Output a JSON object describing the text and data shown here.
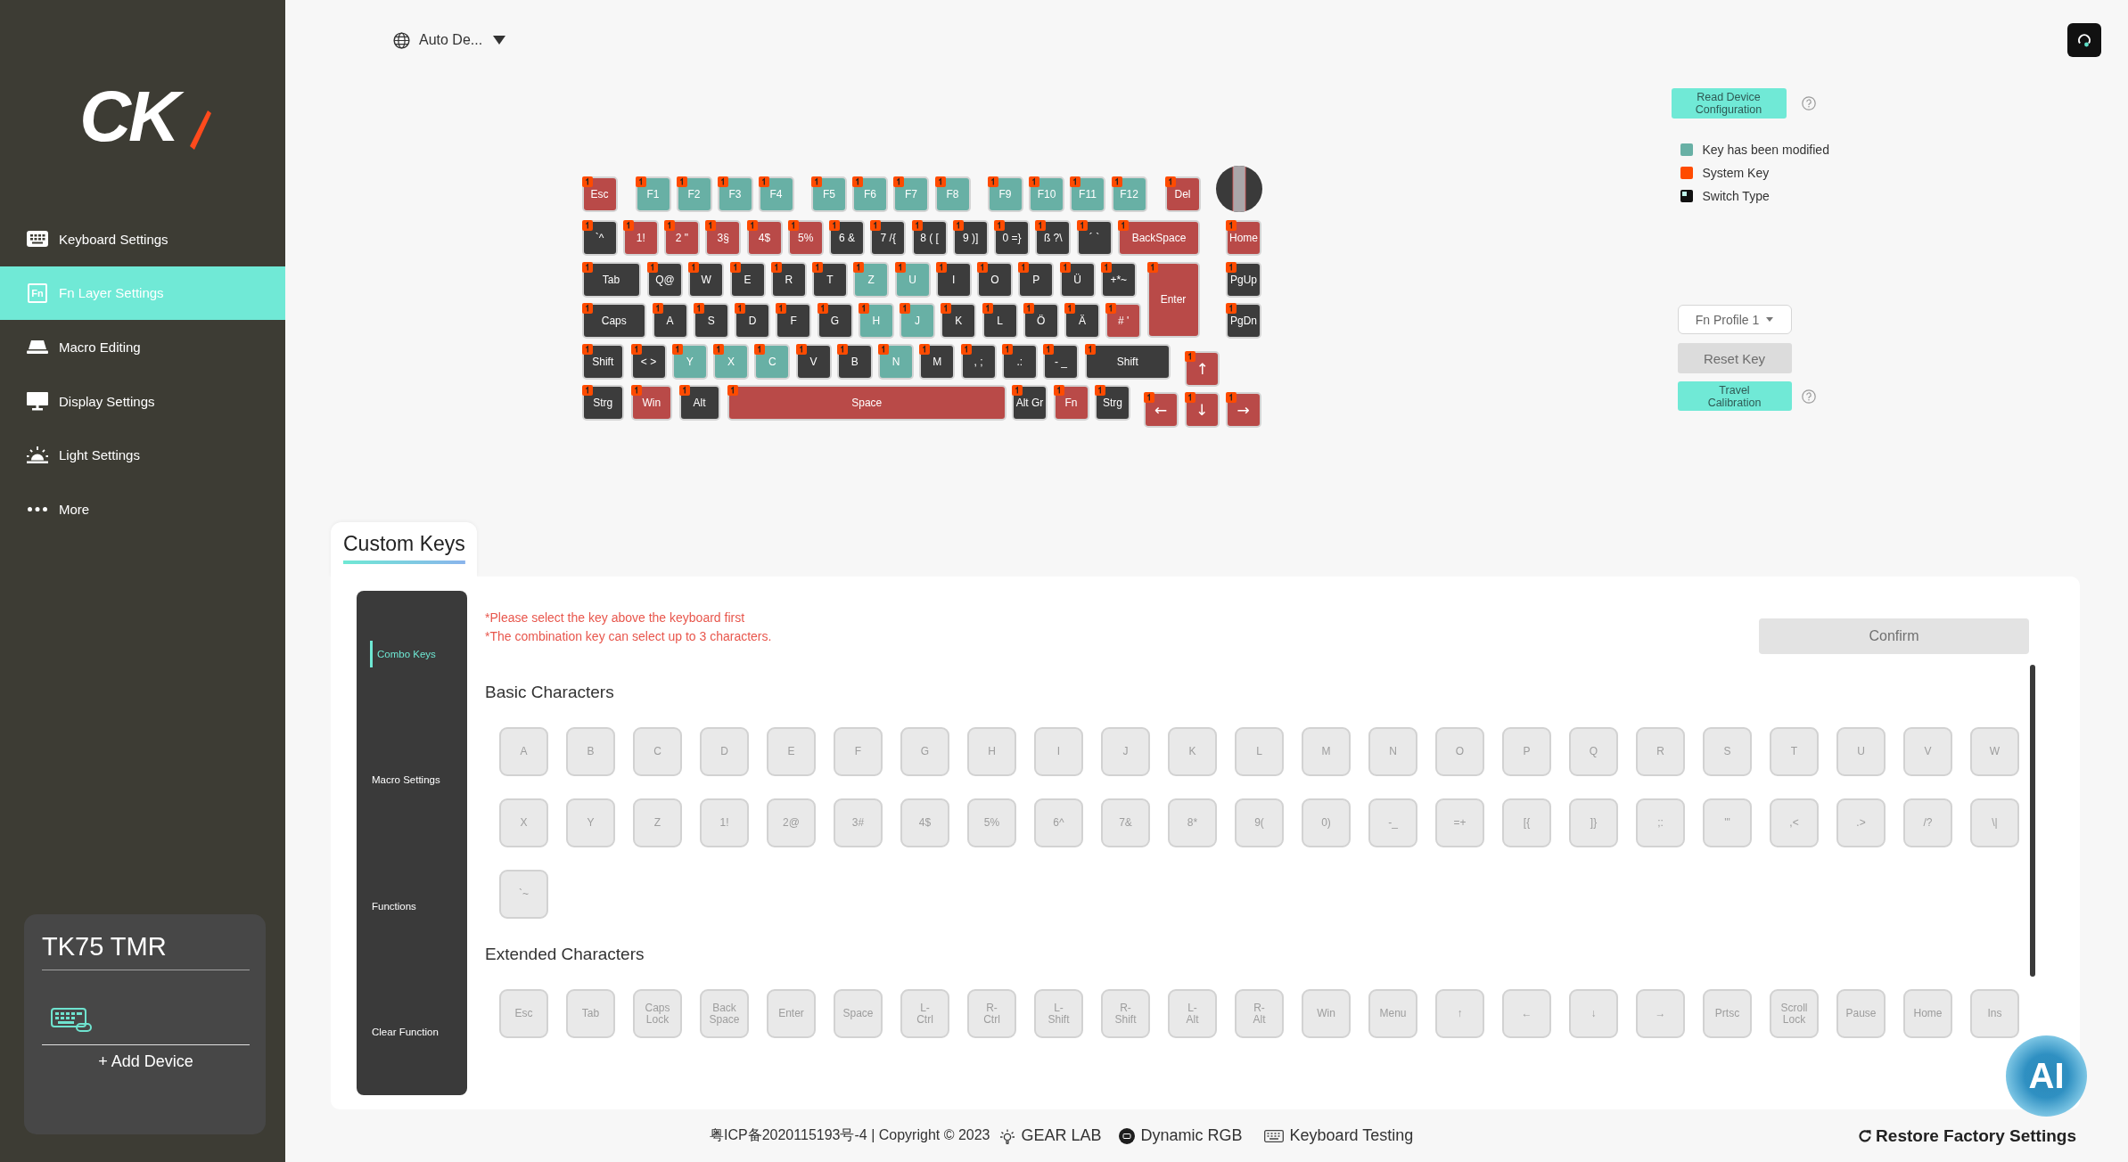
{
  "top_bar": {
    "language": "Auto De..."
  },
  "sidebar": {
    "logo": "CK",
    "items": [
      {
        "label": "Keyboard Settings",
        "selected": false
      },
      {
        "label": "Fn Layer Settings",
        "selected": true,
        "icon_label": "Fn"
      },
      {
        "label": "Macro Editing",
        "selected": false
      },
      {
        "label": "Display Settings",
        "selected": false
      },
      {
        "label": "Light Settings",
        "selected": false
      },
      {
        "label": "More",
        "selected": false
      }
    ],
    "device": {
      "name": "TK75 TMR",
      "add_button": "+ Add Device"
    }
  },
  "keyboard": {
    "rows": [
      {
        "keys": [
          {
            "label": "Esc",
            "color": "#b94a48",
            "system": true
          },
          {
            "label": "F1",
            "color": "#68b0a5",
            "system": true
          },
          {
            "label": "F2",
            "color": "#68b0a5",
            "system": true
          },
          {
            "label": "F3",
            "color": "#68b0a5",
            "system": true
          },
          {
            "label": "F4",
            "color": "#68b0a5",
            "system": true
          },
          {
            "label": "F5",
            "color": "#68b0a5",
            "system": true
          },
          {
            "label": "F6",
            "color": "#68b0a5",
            "system": true
          },
          {
            "label": "F7",
            "color": "#68b0a5",
            "system": true
          },
          {
            "label": "F8",
            "color": "#68b0a5",
            "system": true
          },
          {
            "label": "F9",
            "color": "#68b0a5",
            "system": true
          },
          {
            "label": "F10",
            "color": "#68b0a5",
            "system": true
          },
          {
            "label": "F11",
            "color": "#68b0a5",
            "system": true
          },
          {
            "label": "F12",
            "color": "#68b0a5",
            "system": true
          },
          {
            "label": "Del",
            "color": "#b94a48",
            "system": true
          }
        ]
      },
      {
        "keys": [
          {
            "label": "`^",
            "color": "#3c3c3c",
            "system": true
          },
          {
            "label": "1!",
            "color": "#b94a48",
            "system": true
          },
          {
            "label": "2 \"",
            "color": "#b94a48",
            "system": true
          },
          {
            "label": "3§",
            "color": "#b94a48",
            "system": true
          },
          {
            "label": "4$",
            "color": "#b94a48",
            "system": true
          },
          {
            "label": "5%",
            "color": "#b94a48",
            "system": true
          },
          {
            "label": "6 &",
            "color": "#3c3c3c",
            "system": true
          },
          {
            "label": "7 /{",
            "color": "#3c3c3c",
            "system": true
          },
          {
            "label": "8 ( [",
            "color": "#3c3c3c",
            "system": true
          },
          {
            "label": "9 )]",
            "color": "#3c3c3c",
            "system": true
          },
          {
            "label": "0 =}",
            "color": "#3c3c3c",
            "system": true
          },
          {
            "label": "ß ?\\",
            "color": "#3c3c3c",
            "system": true
          },
          {
            "label": "´ `",
            "color": "#3c3c3c",
            "system": true
          },
          {
            "label": "BackSpace",
            "color": "#b94a48",
            "system": true
          },
          {
            "label": "Home",
            "color": "#b94a48",
            "system": true
          }
        ]
      },
      {
        "keys": [
          {
            "label": "Tab",
            "color": "#3c3c3c",
            "system": true
          },
          {
            "label": "Q@",
            "color": "#3c3c3c",
            "system": true
          },
          {
            "label": "W",
            "color": "#3c3c3c",
            "system": true
          },
          {
            "label": "E",
            "color": "#3c3c3c",
            "system": true
          },
          {
            "label": "R",
            "color": "#3c3c3c",
            "system": true
          },
          {
            "label": "T",
            "color": "#3c3c3c",
            "system": true
          },
          {
            "label": "Z",
            "color": "#68b0a5",
            "system": true
          },
          {
            "label": "U",
            "color": "#68b0a5",
            "system": true
          },
          {
            "label": "I",
            "color": "#3c3c3c",
            "system": true
          },
          {
            "label": "O",
            "color": "#3c3c3c",
            "system": true
          },
          {
            "label": "P",
            "color": "#3c3c3c",
            "system": true
          },
          {
            "label": "Ü",
            "color": "#3c3c3c",
            "system": true
          },
          {
            "label": "+*~",
            "color": "#3c3c3c",
            "system": true
          },
          {
            "label": "Enter",
            "color": "#b94a48",
            "system": true
          },
          {
            "label": "PgUp",
            "color": "#3c3c3c",
            "system": true
          }
        ]
      },
      {
        "keys": [
          {
            "label": "Caps",
            "color": "#3c3c3c",
            "system": true
          },
          {
            "label": "A",
            "color": "#3c3c3c",
            "system": true
          },
          {
            "label": "S",
            "color": "#3c3c3c",
            "system": true
          },
          {
            "label": "D",
            "color": "#3c3c3c",
            "system": true
          },
          {
            "label": "F",
            "color": "#3c3c3c",
            "system": true
          },
          {
            "label": "G",
            "color": "#3c3c3c",
            "system": true
          },
          {
            "label": "H",
            "color": "#68b0a5",
            "system": true
          },
          {
            "label": "J",
            "color": "#68b0a5",
            "system": true
          },
          {
            "label": "K",
            "color": "#3c3c3c",
            "system": true
          },
          {
            "label": "L",
            "color": "#3c3c3c",
            "system": true
          },
          {
            "label": "Ö",
            "color": "#3c3c3c",
            "system": true
          },
          {
            "label": "Ä",
            "color": "#3c3c3c",
            "system": true
          },
          {
            "label": "# '",
            "color": "#b94a48",
            "system": true
          },
          {
            "label": "PgDn",
            "color": "#3c3c3c",
            "system": true
          }
        ]
      },
      {
        "keys": [
          {
            "label": "Shift",
            "color": "#3c3c3c",
            "system": true
          },
          {
            "label": "< >",
            "color": "#3c3c3c",
            "system": true
          },
          {
            "label": "Y",
            "color": "#68b0a5",
            "system": true
          },
          {
            "label": "X",
            "color": "#68b0a5",
            "system": true
          },
          {
            "label": "C",
            "color": "#68b0a5",
            "system": true
          },
          {
            "label": "V",
            "color": "#3c3c3c",
            "system": true
          },
          {
            "label": "B",
            "color": "#3c3c3c",
            "system": true
          },
          {
            "label": "N",
            "color": "#68b0a5",
            "system": true
          },
          {
            "label": "M",
            "color": "#3c3c3c",
            "system": true
          },
          {
            "label": ", ;",
            "color": "#3c3c3c",
            "system": true
          },
          {
            "label": ".:",
            "color": "#3c3c3c",
            "system": true
          },
          {
            "label": "- _",
            "color": "#3c3c3c",
            "system": true
          },
          {
            "label": "Shift",
            "color": "#3c3c3c",
            "system": true
          },
          {
            "label": "↑",
            "color": "#b94a48",
            "system": true
          }
        ]
      },
      {
        "keys": [
          {
            "label": "Strg",
            "color": "#3c3c3c",
            "system": true
          },
          {
            "label": "Win",
            "color": "#b94a48",
            "system": true
          },
          {
            "label": "Alt",
            "color": "#3c3c3c",
            "system": true
          },
          {
            "label": "Space",
            "color": "#b94a48",
            "system": true
          },
          {
            "label": "Alt Gr",
            "color": "#3c3c3c",
            "system": true
          },
          {
            "label": "Fn",
            "color": "#b94a48",
            "system": true
          },
          {
            "label": "Strg",
            "color": "#3c3c3c",
            "system": true
          },
          {
            "label": "←",
            "color": "#b94a48",
            "system": true
          },
          {
            "label": "↓",
            "color": "#b94a48",
            "system": true
          },
          {
            "label": "→",
            "color": "#b94a48",
            "system": true
          }
        ]
      }
    ]
  },
  "right_panel": {
    "read_button": "Read Device Configuration",
    "legend": [
      {
        "kind": "swatch",
        "label": "Key has been modified",
        "color": "#68b0a5"
      },
      {
        "kind": "swatch",
        "label": "System Key",
        "color": "#ff4b00"
      },
      {
        "kind": "switch",
        "label": "Switch Type"
      }
    ],
    "profile_select": "Fn Profile 1",
    "reset_button": {
      "label": "Reset Key",
      "disabled": true
    },
    "calibration_button": "Travel Calibration"
  },
  "custom_keys": {
    "tabs": [
      {
        "label": "Custom Keys",
        "selected": true
      }
    ],
    "menu": [
      {
        "label": "Combo Keys",
        "selected": true
      },
      {
        "label": "Macro Settings",
        "selected": false
      },
      {
        "label": "Functions",
        "selected": false
      },
      {
        "label": "Clear Function",
        "selected": false
      }
    ],
    "notices": [
      "*Please select the key above the keyboard first",
      "*The combination key can select up to 3 characters."
    ],
    "confirm_button": {
      "label": "Confirm",
      "disabled": true
    },
    "sections": [
      {
        "title": "Basic Characters",
        "keys": [
          "A",
          "B",
          "C",
          "D",
          "E",
          "F",
          "G",
          "H",
          "I",
          "J",
          "K",
          "L",
          "M",
          "N",
          "O",
          "P",
          "Q",
          "R",
          "S",
          "T",
          "U",
          "V",
          "W",
          "X",
          "Y",
          "Z",
          "1!",
          "2@",
          "3#",
          "4$",
          "5%",
          "6^",
          "7&",
          "8*",
          "9(",
          "0)",
          "-_",
          "=+",
          "[{",
          "]}",
          ";:",
          "'\"",
          ",<",
          ".>",
          "/?",
          "\\|",
          "`~"
        ]
      },
      {
        "title": "Extended Characters",
        "keys": [
          "Esc",
          "Tab",
          "Caps Lock",
          "Back Space",
          "Enter",
          "Space",
          "L-Ctrl",
          "R-Ctrl",
          "L-Shift",
          "R-Shift",
          "L-Alt",
          "R-Alt",
          "Win",
          "Menu",
          "↑",
          "←",
          "↓",
          "→",
          "Prtsc",
          "Scroll Lock",
          "Pause",
          "Home",
          "Ins"
        ]
      }
    ]
  },
  "ai_button": "AI",
  "footer": {
    "copyright": "粤ICP备2020115193号-4 | Copyright © 2023",
    "links": [
      "GEAR LAB",
      "Dynamic RGB",
      "Keyboard Testing"
    ],
    "restore_button": "Restore Factory Settings"
  }
}
